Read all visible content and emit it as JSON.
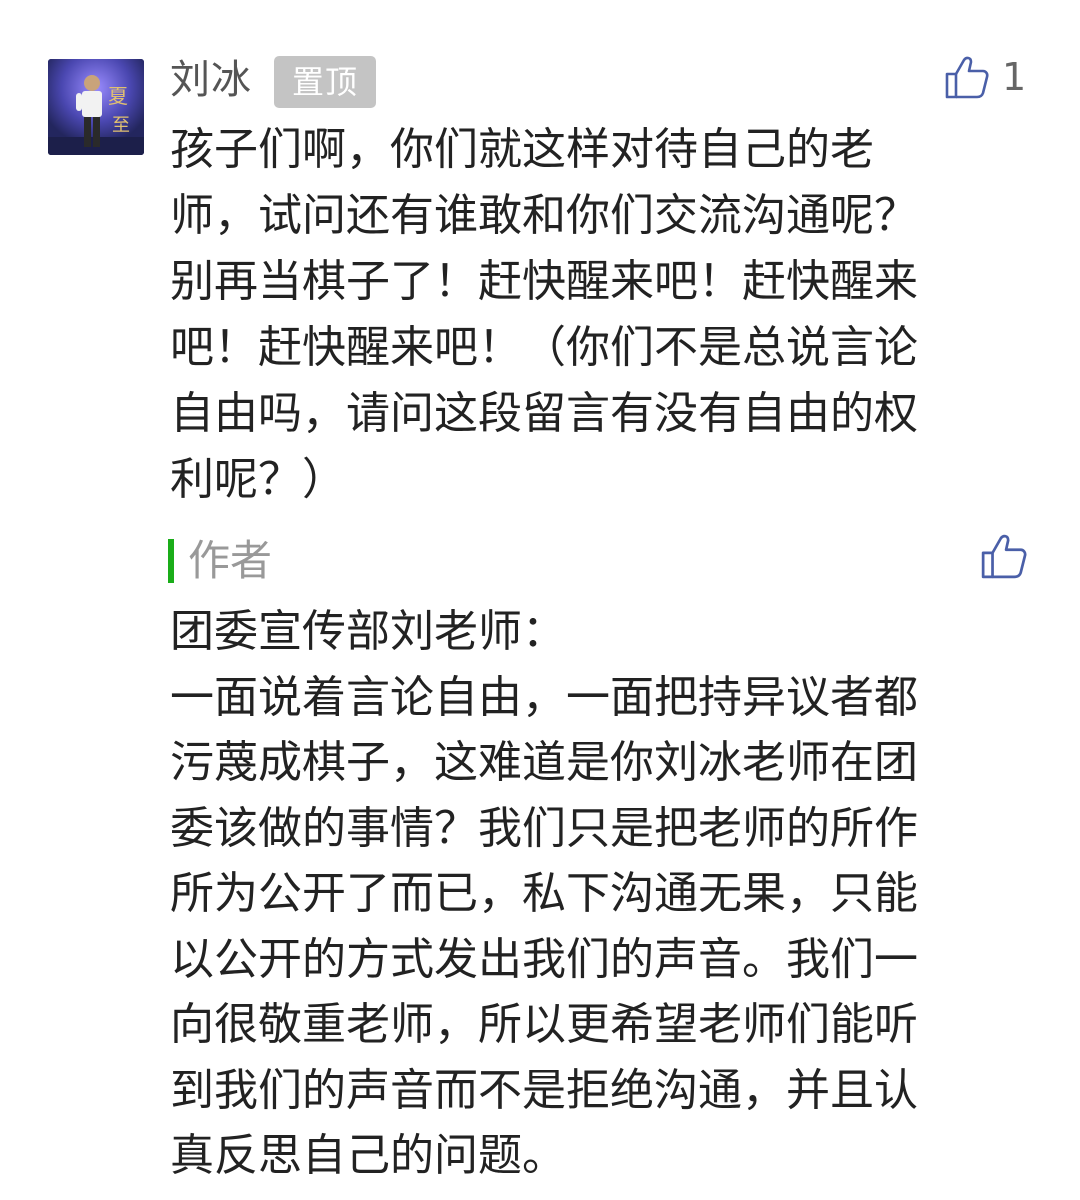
{
  "comment": {
    "author": "刘冰",
    "badge": "置顶",
    "likes": "1",
    "text": "孩子们啊，你们就这样对待自己的老\n师，试问还有谁敢和你们交流沟通呢？\n别再当棋子了！赶快醒来吧！赶快醒来\n吧！赶快醒来吧！（你们不是总说言论\n自由吗，请问这段留言有没有自由的权\n利呢？）",
    "avatar_icon": "person-on-stage-photo",
    "like_icon": "thumbs-up-icon"
  },
  "reply": {
    "label": "作者",
    "accent_color": "#1aad19",
    "like_icon": "thumbs-up-icon",
    "text": "团委宣传部刘老师：\n一面说着言论自由，一面把持异议者都\n污蔑成棋子，这难道是你刘冰老师在团\n委该做的事情？我们只是把老师的所作\n所为公开了而已，私下沟通无果，只能\n以公开的方式发出我们的声音。我们一\n向很敬重老师，所以更希望老师们能听\n到我们的声音而不是拒绝沟通，并且认\n真反思自己的问题。"
  },
  "colors": {
    "like_icon": "#4a5fa8",
    "badge_bg": "#c4c4c4",
    "text": "#222222",
    "muted": "#999999"
  }
}
